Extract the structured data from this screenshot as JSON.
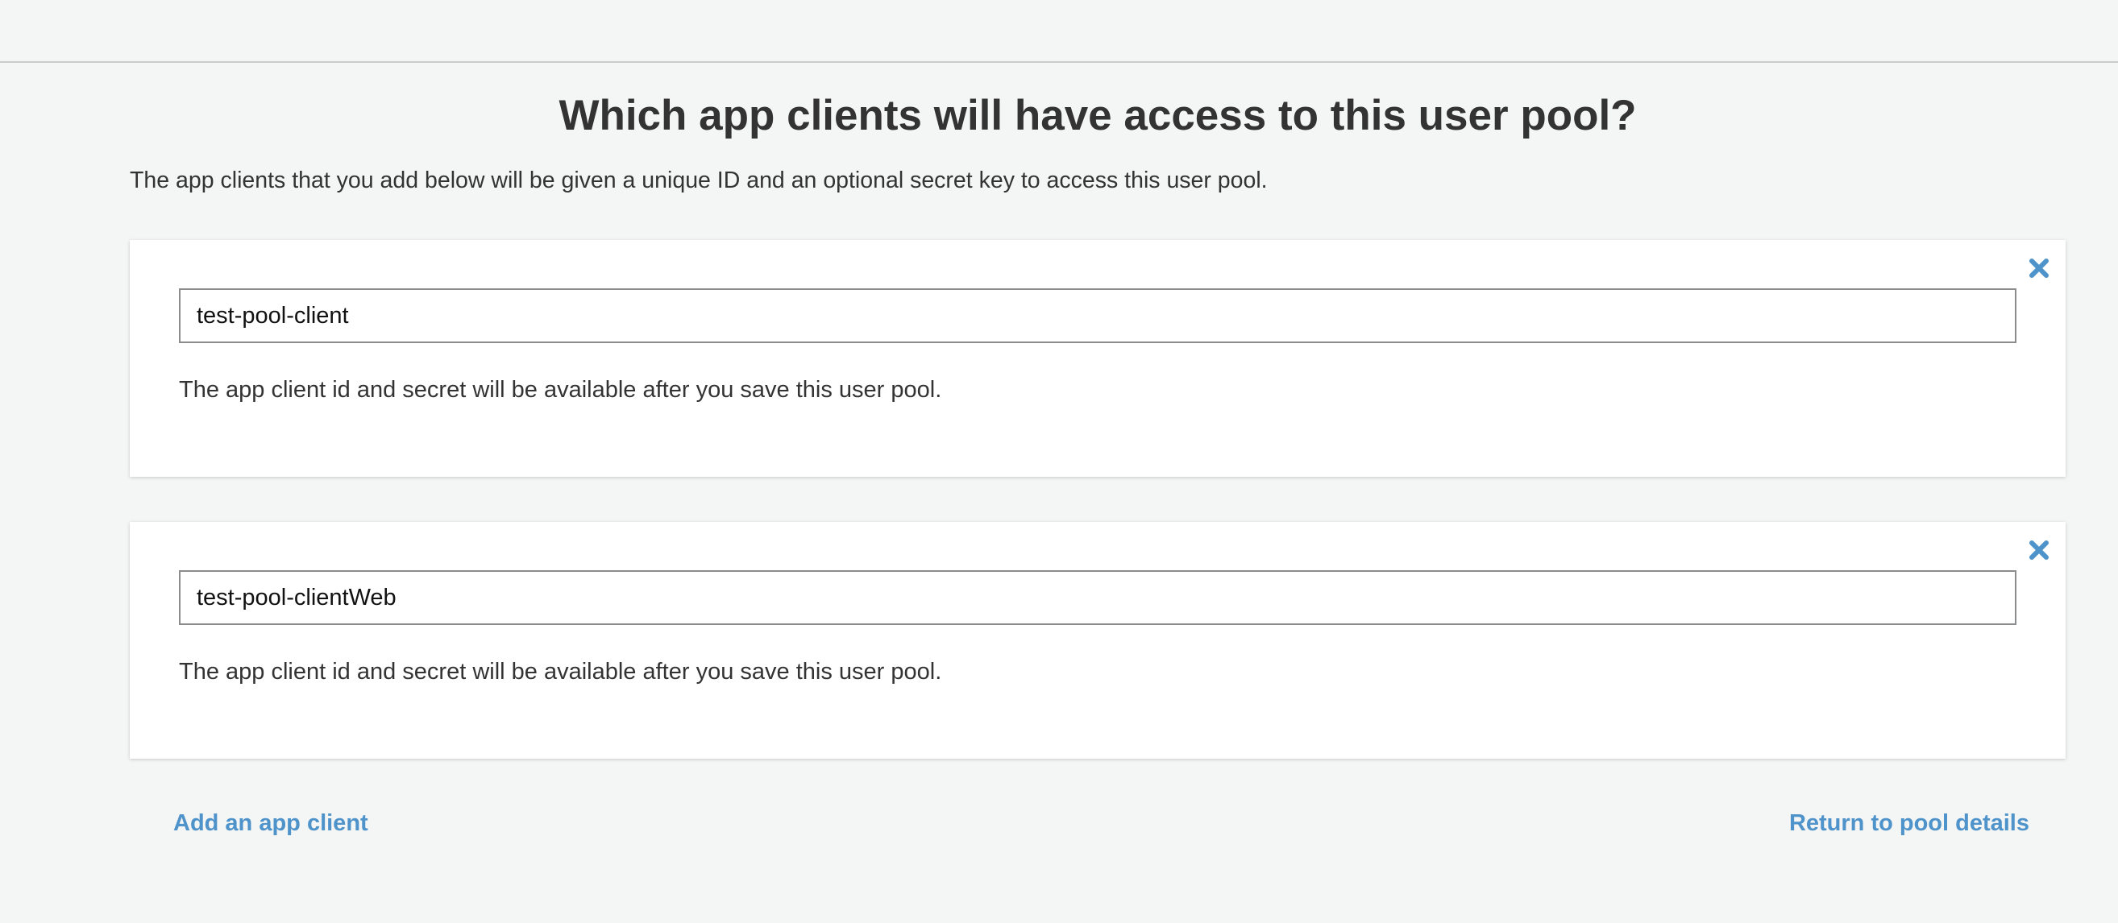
{
  "page": {
    "title": "Which app clients will have access to this user pool?",
    "description": "The app clients that you add below will be given a unique ID and an optional secret key to access this user pool."
  },
  "clients": [
    {
      "name": "test-pool-client",
      "note": "The app client id and secret will be available after you save this user pool.",
      "remove_icon": "close-x-icon"
    },
    {
      "name": "test-pool-clientWeb",
      "note": "The app client id and secret will be available after you save this user pool.",
      "remove_icon": "close-x-icon"
    }
  ],
  "actions": {
    "add_label": "Add an app client",
    "return_label": "Return to pool details"
  },
  "colors": {
    "accent": "#4f93cb",
    "background": "#f4f5f5",
    "card": "#ffffff",
    "text": "#333333"
  }
}
